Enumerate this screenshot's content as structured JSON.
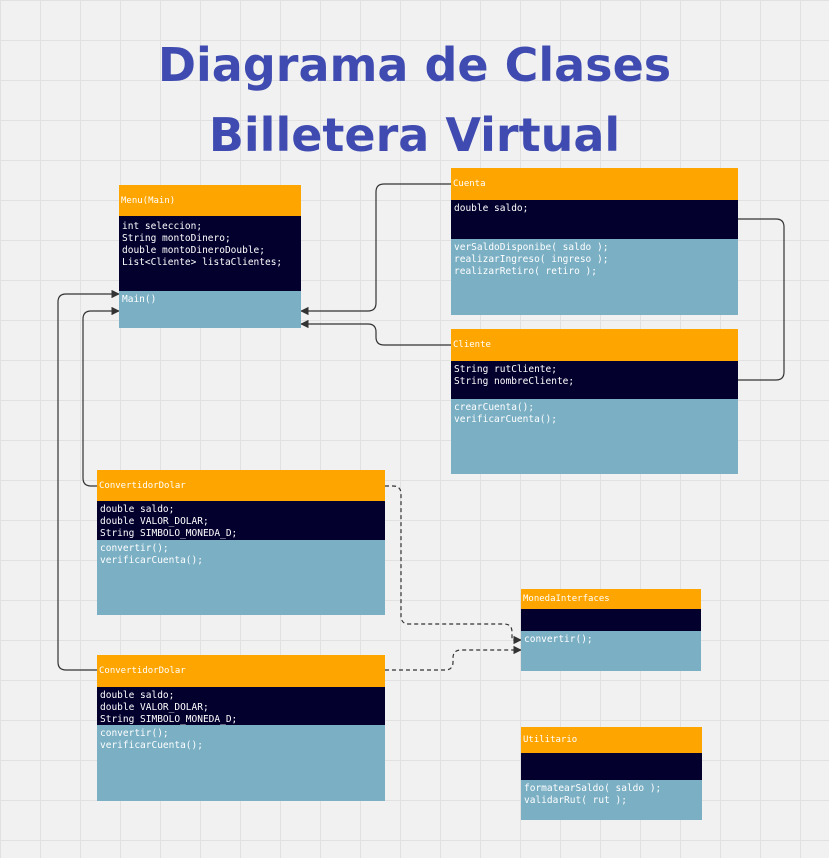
{
  "title": {
    "line1": "Diagrama de Clases",
    "line2": "Billetera Virtual"
  },
  "classes": {
    "menu": {
      "name": "Menu(Main)",
      "attributes": [
        "int seleccion;",
        "String montoDinero;",
        "double montoDineroDouble;",
        "List<Cliente> listaClientes;"
      ],
      "methods": [
        "Main()"
      ]
    },
    "cuenta": {
      "name": "Cuenta",
      "attributes": [
        "double saldo;"
      ],
      "methods": [
        "verSaldoDisponibe( saldo );",
        "realizarIngreso( ingreso );",
        "realizarRetiro( retiro );"
      ]
    },
    "cliente": {
      "name": "Cliente",
      "attributes": [
        "String rutCliente;",
        "String nombreCliente;"
      ],
      "methods": [
        "crearCuenta();",
        "verificarCuenta();"
      ]
    },
    "convertidor1": {
      "name": "ConvertidorDolar",
      "attributes": [
        "double saldo;",
        "double VALOR_DOLAR;",
        "String SIMBOLO_MONEDA_D;"
      ],
      "methods": [
        "convertir();",
        "verificarCuenta();"
      ]
    },
    "convertidor2": {
      "name": "ConvertidorDolar",
      "attributes": [
        "double saldo;",
        "double VALOR_DOLAR;",
        "String SIMBOLO_MONEDA_D;"
      ],
      "methods": [
        "convertir();",
        "verificarCuenta();"
      ]
    },
    "moneda": {
      "name": "MonedaInterfaces",
      "attributes": [],
      "methods": [
        "convertir();"
      ]
    },
    "utilitario": {
      "name": "Utilitario",
      "attributes": [],
      "methods": [
        "formatearSaldo( saldo );",
        "validarRut( rut );"
      ]
    }
  },
  "relations": [
    {
      "from": "Cuenta",
      "to": "Menu(Main)",
      "style": "solid-arrow"
    },
    {
      "from": "Cliente",
      "to": "Menu(Main)",
      "style": "solid-arrow"
    },
    {
      "from": "Cuenta",
      "to": "Cliente",
      "style": "solid-line"
    },
    {
      "from": "ConvertidorDolar",
      "to": "Menu(Main)",
      "style": "solid-arrow"
    },
    {
      "from": "ConvertidorDolar",
      "to": "Menu(Main)",
      "style": "solid-arrow"
    },
    {
      "from": "ConvertidorDolar",
      "to": "MonedaInterfaces",
      "style": "dashed-arrow"
    },
    {
      "from": "ConvertidorDolar",
      "to": "MonedaInterfaces",
      "style": "dashed-arrow"
    }
  ]
}
